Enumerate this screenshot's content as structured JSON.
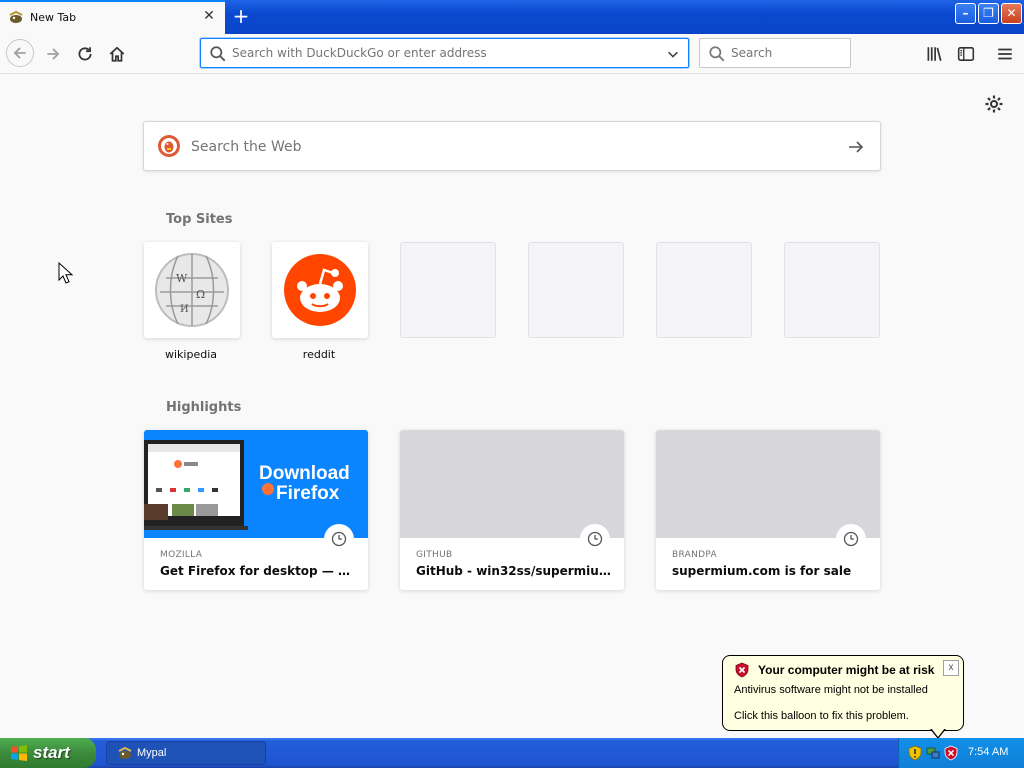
{
  "browser": {
    "tab": {
      "title": "New Tab",
      "icon": "mypal-icon"
    },
    "new_tab_label": "+",
    "window_buttons": {
      "minimize": "–",
      "maximize": "❐",
      "close": "✕"
    },
    "urlbar": {
      "placeholder": "Search with DuckDuckGo or enter address"
    },
    "searchbar": {
      "placeholder": "Search"
    }
  },
  "newtab": {
    "websearch": {
      "placeholder": "Search the Web"
    },
    "top_sites_title": "Top Sites",
    "top_sites": [
      {
        "label": "wikipedia",
        "icon": "wikipedia-globe-icon"
      },
      {
        "label": "reddit",
        "icon": "reddit-alien-icon",
        "color": "#ff4500"
      },
      {
        "label": ""
      },
      {
        "label": ""
      },
      {
        "label": ""
      },
      {
        "label": ""
      }
    ],
    "highlights_title": "Highlights",
    "highlights": [
      {
        "source": "MOZILLA",
        "title": "Get Firefox for desktop — Mozill...",
        "thumb_text_1": "Download",
        "thumb_text_2": "Firefox",
        "thumb_color": "#0a84ff"
      },
      {
        "source": "GITHUB",
        "title": "GitHub - win32ss/supermium: C..."
      },
      {
        "source": "BRANDPA",
        "title": "supermium.com is for sale"
      }
    ]
  },
  "balloon": {
    "title": "Your computer might be at risk",
    "line1": "Antivirus software might not be installed",
    "line2": "Click this balloon to fix this problem.",
    "close": "x"
  },
  "taskbar": {
    "start_label": "start",
    "task_label": "Mypal",
    "clock": "7:54 AM"
  },
  "colors": {
    "accent": "#0a84ff",
    "taskbar": "#245edb",
    "start": "#3c8b3c",
    "balloon_bg": "#ffffe1"
  }
}
